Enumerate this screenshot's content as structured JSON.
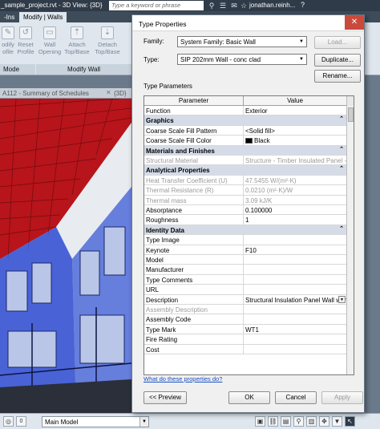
{
  "titlebar": {
    "title": "_sample_project.rvt - 3D View: {3D}",
    "search_placeholder": "Type a keyword or phrase",
    "user": "jonathan.reinh...",
    "help": "?"
  },
  "ribbon": {
    "tabs": [
      "-Ins",
      "Modify | Walls"
    ],
    "buttons": [
      {
        "label": "odify\nofile",
        "icon": "edit-profile-icon"
      },
      {
        "label": "Reset\nProfile",
        "icon": "reset-profile-icon"
      },
      {
        "label": "Wall\nOpening",
        "icon": "wall-opening-icon"
      },
      {
        "label": "Attach\nTop/Base",
        "icon": "attach-icon"
      },
      {
        "label": "Detach\nTop/Base",
        "icon": "detach-icon"
      }
    ],
    "panels": [
      "Mode",
      "Modify Wall"
    ]
  },
  "view_tabs": {
    "active": "A112 - Summary of Schedules",
    "next": "{3D}"
  },
  "status_bar": {
    "model": "Main Model",
    "zero": "0"
  },
  "dialog": {
    "title": "Type Properties",
    "close": "✕",
    "family_label": "Family:",
    "family_value": "System Family: Basic Wall",
    "type_label": "Type:",
    "type_value": "SIP 202mm Wall - conc clad",
    "load_button": "Load...",
    "duplicate_button": "Duplicate...",
    "rename_button": "Rename...",
    "type_parameters_label": "Type Parameters",
    "col_parameter": "Parameter",
    "col_value": "Value",
    "rows": [
      {
        "kind": "row",
        "name": "Function",
        "value": "Exterior"
      },
      {
        "kind": "group",
        "name": "Graphics"
      },
      {
        "kind": "row",
        "name": "Coarse Scale Fill Pattern",
        "value": "<Solid fill>"
      },
      {
        "kind": "row",
        "name": "Coarse Scale Fill Color",
        "value": "Black",
        "swatch": true
      },
      {
        "kind": "group",
        "name": "Materials and Finishes"
      },
      {
        "kind": "row",
        "name": "Structural Material",
        "value": "Structure - Timber Insulated Panel -",
        "grey": true
      },
      {
        "kind": "group",
        "name": "Analytical Properties"
      },
      {
        "kind": "row",
        "name": "Heat Transfer Coefficient (U)",
        "value": "47.5455 W/(m²·K)",
        "grey": true
      },
      {
        "kind": "row",
        "name": "Thermal Resistance (R)",
        "value": "0.0210 (m²·K)/W",
        "grey": true
      },
      {
        "kind": "row",
        "name": "Thermal mass",
        "value": "3.09 kJ/K",
        "grey": true
      },
      {
        "kind": "row",
        "name": "Absorptance",
        "value": "0.100000"
      },
      {
        "kind": "row",
        "name": "Roughness",
        "value": "1"
      },
      {
        "kind": "group",
        "name": "Identity Data"
      },
      {
        "kind": "row",
        "name": "Type Image",
        "value": ""
      },
      {
        "kind": "row",
        "name": "Keynote",
        "value": "F10"
      },
      {
        "kind": "row",
        "name": "Model",
        "value": ""
      },
      {
        "kind": "row",
        "name": "Manufacturer",
        "value": ""
      },
      {
        "kind": "row",
        "name": "Type Comments",
        "value": ""
      },
      {
        "kind": "row",
        "name": "URL",
        "value": ""
      },
      {
        "kind": "row",
        "name": "Description",
        "value": "Structural Insulation Panel Wall with",
        "dropdown": true
      },
      {
        "kind": "row",
        "name": "Assembly Description",
        "value": "",
        "grey": true
      },
      {
        "kind": "row",
        "name": "Assembly Code",
        "value": ""
      },
      {
        "kind": "row",
        "name": "Type Mark",
        "value": "WT1"
      },
      {
        "kind": "row",
        "name": "Fire Rating",
        "value": ""
      },
      {
        "kind": "row",
        "name": "Cost",
        "value": ""
      }
    ],
    "help_link": "What do these properties do?",
    "preview_button": "<< Preview",
    "ok_button": "OK",
    "cancel_button": "Cancel",
    "apply_button": "Apply"
  }
}
